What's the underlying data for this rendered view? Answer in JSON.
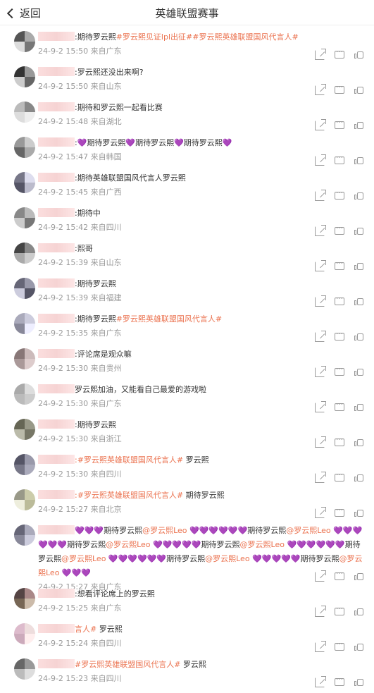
{
  "header": {
    "back_label": "返回",
    "title": "英雄联盟赛事"
  },
  "comments": [
    {
      "segments": [
        {
          "t": "text",
          "v": ":期待罗云熙"
        },
        {
          "t": "tag",
          "v": "#罗云熙见证lpl出征#"
        },
        {
          "t": "tag",
          "v": "#罗云熙英雄联盟国风代言人#"
        }
      ],
      "meta": "24-9-2 15:50 来自广东"
    },
    {
      "segments": [
        {
          "t": "text",
          "v": ":罗云熙还没出来啊?"
        }
      ],
      "meta": "24-9-2 15:50 来自山东"
    },
    {
      "segments": [
        {
          "t": "text",
          "v": ":期待和罗云熙一起看比赛"
        }
      ],
      "meta": "24-9-2 15:48 来自湖北"
    },
    {
      "segments": [
        {
          "t": "text",
          "v": ":💜期待罗云熙💜期待罗云熙💜期待罗云熙💜"
        }
      ],
      "meta": "24-9-2 15:47 来自韩国"
    },
    {
      "segments": [
        {
          "t": "text",
          "v": ":期待英雄联盟国风代言人罗云熙"
        }
      ],
      "meta": "24-9-2 15:45 来自广西"
    },
    {
      "segments": [
        {
          "t": "text",
          "v": ":期待中"
        }
      ],
      "meta": "24-9-2 15:42 来自四川"
    },
    {
      "segments": [
        {
          "t": "text",
          "v": ":熙哥"
        }
      ],
      "meta": "24-9-2 15:39 来自山东"
    },
    {
      "segments": [
        {
          "t": "text",
          "v": ":期待罗云熙"
        }
      ],
      "meta": "24-9-2 15:39 来自福建"
    },
    {
      "segments": [
        {
          "t": "text",
          "v": ":期待罗云熙"
        },
        {
          "t": "tag",
          "v": "#罗云熙英雄联盟国风代言人#"
        }
      ],
      "meta": "24-9-2 15:35 来自广东"
    },
    {
      "segments": [
        {
          "t": "text",
          "v": ":评论席是观众嘛"
        }
      ],
      "meta": "24-9-2 15:30 来自贵州"
    },
    {
      "segments": [
        {
          "t": "text",
          "v": "罗云熙加油，又能看自己最爱的游戏啦"
        }
      ],
      "meta": "24-9-2 15:30 来自广东"
    },
    {
      "segments": [
        {
          "t": "text",
          "v": ":期待罗云熙"
        }
      ],
      "meta": "24-9-2 15:30 来自浙江"
    },
    {
      "segments": [
        {
          "t": "tag",
          "v": ":#罗云熙英雄联盟国风代言人#"
        },
        {
          "t": "text",
          "v": " 罗云熙"
        }
      ],
      "meta": "24-9-2 15:30 来自四川"
    },
    {
      "segments": [
        {
          "t": "tag",
          "v": ":#罗云熙英雄联盟国风代言人#"
        },
        {
          "t": "text",
          "v": " 期待罗云熙"
        }
      ],
      "meta": "24-9-2 15:27 来自北京"
    },
    {
      "segments": [
        {
          "t": "text",
          "v": "💜💜💜期待罗云熙"
        },
        {
          "t": "ment",
          "v": "@罗云熙Leo"
        },
        {
          "t": "text",
          "v": " 💜💜💜💜💜💜期待罗云熙"
        },
        {
          "t": "ment",
          "v": "@罗云熙Leo"
        },
        {
          "t": "text",
          "v": " 💜💜💜💜💜💜期待罗云熙"
        },
        {
          "t": "ment",
          "v": "@罗云熙Leo"
        },
        {
          "t": "text",
          "v": " 💜💜💜💜💜期待罗云熙"
        },
        {
          "t": "ment",
          "v": "@罗云熙Leo"
        },
        {
          "t": "text",
          "v": " 💜💜💜💜💜💜期待罗云熙"
        },
        {
          "t": "ment",
          "v": "@罗云熙Leo"
        },
        {
          "t": "text",
          "v": " 💜💜💜💜💜💜期待罗云熙"
        },
        {
          "t": "ment",
          "v": "@罗云熙Leo"
        },
        {
          "t": "text",
          "v": " 💜💜💜💜💜期待罗云熙"
        },
        {
          "t": "ment",
          "v": "@罗云熙Leo"
        },
        {
          "t": "text",
          "v": " 💜💜💜"
        }
      ],
      "meta": "24-9-2 15:27 来自广东"
    },
    {
      "segments": [
        {
          "t": "text",
          "v": ":想看评论席上的罗云熙"
        }
      ],
      "meta": "24-9-2 15:25 来自广东"
    },
    {
      "segments": [
        {
          "t": "tag",
          "v": "言人#"
        },
        {
          "t": "text",
          "v": " 罗云熙"
        }
      ],
      "meta": "24-9-2 15:24 来自四川"
    },
    {
      "segments": [
        {
          "t": "tag",
          "v": "#罗云熙英雄联盟国风代言人#"
        },
        {
          "t": "text",
          "v": " 罗云熙"
        }
      ],
      "meta": "24-9-2 15:23 来自四川"
    }
  ],
  "colors": {
    "accent": "#eb7350",
    "meta": "#999999"
  }
}
